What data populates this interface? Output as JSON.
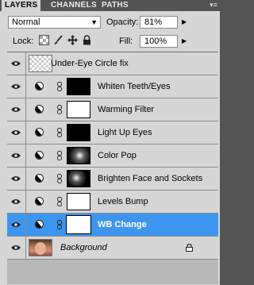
{
  "tabs": [
    {
      "label": "LAYERS",
      "active": true
    },
    {
      "label": "CHANNELS",
      "active": false
    },
    {
      "label": "PATHS",
      "active": false
    }
  ],
  "blend_mode": "Normal",
  "opacity": {
    "label": "Opacity:",
    "value": "81%"
  },
  "lock": {
    "label": "Lock:"
  },
  "fill": {
    "label": "Fill:",
    "value": "100%"
  },
  "layers": [
    {
      "name": "Under-Eye Circle fix",
      "kind": "pixel",
      "selected": false
    },
    {
      "name": "Whiten Teeth/Eyes",
      "kind": "adjustment",
      "mask": "black",
      "selected": false
    },
    {
      "name": "Warming Filter",
      "kind": "adjustment",
      "mask": "white",
      "selected": false
    },
    {
      "name": "Light Up Eyes",
      "kind": "adjustment",
      "mask": "black",
      "selected": false
    },
    {
      "name": "Color Pop",
      "kind": "adjustment",
      "mask": "pop",
      "selected": false
    },
    {
      "name": "Brighten Face and Sockets",
      "kind": "adjustment",
      "mask": "brighten",
      "selected": false
    },
    {
      "name": "Levels Bump",
      "kind": "adjustment",
      "mask": "white",
      "selected": false
    },
    {
      "name": "WB Change",
      "kind": "adjustment",
      "mask": "wb",
      "selected": true
    },
    {
      "name": "Background",
      "kind": "background",
      "locked": true,
      "selected": false
    }
  ],
  "colors": {
    "selected_row": "#3c96f0",
    "panel": "#d6d6d6"
  }
}
